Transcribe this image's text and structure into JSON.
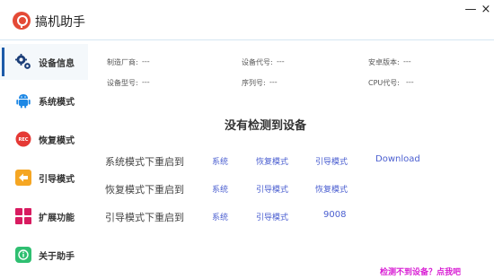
{
  "app": {
    "title": "搞机助手",
    "minimize_glyph": "—",
    "close_glyph": "×"
  },
  "sidebar": {
    "items": [
      {
        "label": "设备信息",
        "icon": "gear-cog-icon",
        "active": true
      },
      {
        "label": "系统模式",
        "icon": "android-icon",
        "active": false
      },
      {
        "label": "恢复模式",
        "icon": "rec-icon",
        "active": false
      },
      {
        "label": "引导模式",
        "icon": "back-arrow-icon",
        "active": false
      },
      {
        "label": "扩展功能",
        "icon": "grid-icon",
        "active": false
      },
      {
        "label": "关于助手",
        "icon": "info-icon",
        "active": false
      }
    ],
    "rec_text": "REC"
  },
  "device_info": {
    "manufacturer": {
      "label": "制造厂商:",
      "value": "---"
    },
    "codename": {
      "label": "设备代号:",
      "value": "---"
    },
    "android_version": {
      "label": "安卓版本:",
      "value": "---"
    },
    "model": {
      "label": "设备型号:",
      "value": "---"
    },
    "serial": {
      "label": "序列号:",
      "value": "---"
    },
    "cpu_codename": {
      "label": "CPU代号:",
      "value": "---"
    }
  },
  "status": {
    "message": "没有检测到设备"
  },
  "reboot": {
    "system_row": {
      "label": "系统模式下重启到",
      "options": [
        "系统",
        "恢复模式",
        "引导模式",
        "Download"
      ]
    },
    "recovery_row": {
      "label": "恢复模式下重启到",
      "options": [
        "系统",
        "引导模式",
        "恢复模式"
      ]
    },
    "bootloader_row": {
      "label": "引导模式下重启到",
      "options": [
        "系统",
        "引导模式",
        "9008"
      ]
    }
  },
  "help": {
    "link_text": "检测不到设备？点我吧"
  },
  "colors": {
    "accent": "#1c5aa8",
    "link": "#4a5ed0",
    "help_link": "#d91fd4",
    "logo": "#e44a36"
  }
}
